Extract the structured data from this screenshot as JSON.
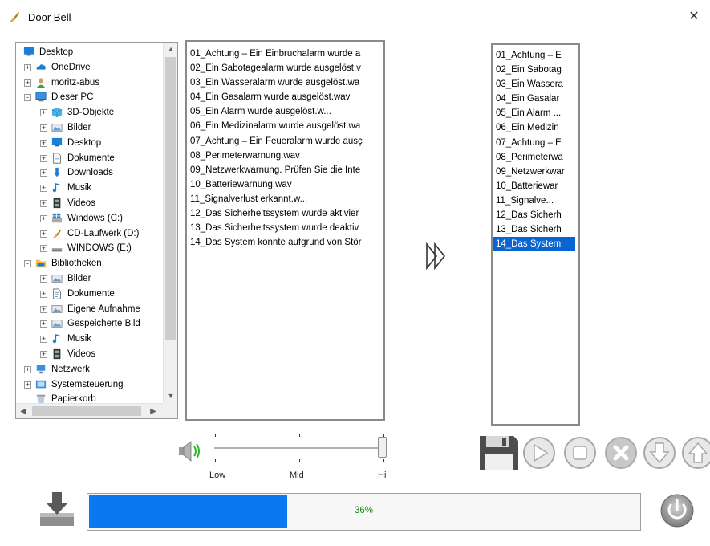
{
  "window": {
    "title": "Door Bell",
    "close_glyph": "✕",
    "icon": "broom-icon"
  },
  "tree": {
    "items": [
      {
        "label": "Desktop",
        "depth": 0,
        "expander": "",
        "icon": "desktop-blue-icon"
      },
      {
        "label": "OneDrive",
        "depth": 1,
        "expander": "+",
        "icon": "cloud-icon"
      },
      {
        "label": "moritz-abus",
        "depth": 1,
        "expander": "+",
        "icon": "user-icon"
      },
      {
        "label": "Dieser PC",
        "depth": 1,
        "expander": "-",
        "icon": "computer-icon"
      },
      {
        "label": "3D-Objekte",
        "depth": 2,
        "expander": "+",
        "icon": "cube-icon"
      },
      {
        "label": "Bilder",
        "depth": 2,
        "expander": "+",
        "icon": "pictures-icon"
      },
      {
        "label": "Desktop",
        "depth": 2,
        "expander": "+",
        "icon": "desktop-blue-icon"
      },
      {
        "label": "Dokumente",
        "depth": 2,
        "expander": "+",
        "icon": "document-icon"
      },
      {
        "label": "Downloads",
        "depth": 2,
        "expander": "+",
        "icon": "download-arrow-icon"
      },
      {
        "label": "Musik",
        "depth": 2,
        "expander": "+",
        "icon": "music-note-icon"
      },
      {
        "label": "Videos",
        "depth": 2,
        "expander": "+",
        "icon": "film-icon"
      },
      {
        "label": "Windows (C:)",
        "depth": 2,
        "expander": "+",
        "icon": "windows-drive-icon"
      },
      {
        "label": "CD-Laufwerk (D:)",
        "depth": 2,
        "expander": "+",
        "icon": "cd-drive-icon"
      },
      {
        "label": "WINDOWS (E:)",
        "depth": 2,
        "expander": "+",
        "icon": "drive-icon"
      },
      {
        "label": "Bibliotheken",
        "depth": 1,
        "expander": "-",
        "icon": "library-folder-icon"
      },
      {
        "label": "Bilder",
        "depth": 2,
        "expander": "+",
        "icon": "pictures-icon"
      },
      {
        "label": "Dokumente",
        "depth": 2,
        "expander": "+",
        "icon": "document-icon"
      },
      {
        "label": "Eigene Aufnahme",
        "depth": 2,
        "expander": "+",
        "icon": "pictures-icon"
      },
      {
        "label": "Gespeicherte Bild",
        "depth": 2,
        "expander": "+",
        "icon": "pictures-icon"
      },
      {
        "label": "Musik",
        "depth": 2,
        "expander": "+",
        "icon": "music-note-icon"
      },
      {
        "label": "Videos",
        "depth": 2,
        "expander": "+",
        "icon": "film-icon"
      },
      {
        "label": "Netzwerk",
        "depth": 1,
        "expander": "+",
        "icon": "network-icon"
      },
      {
        "label": "Systemsteuerung",
        "depth": 1,
        "expander": "+",
        "icon": "control-panel-icon"
      },
      {
        "label": "Papierkorb",
        "depth": 1,
        "expander": "",
        "icon": "recycle-bin-icon"
      }
    ]
  },
  "sound_files": [
    "01_Achtung – Ein Einbruchalarm wurde a",
    "02_Ein Sabotagealarm wurde ausgelöst.v",
    "03_Ein Wasseralarm wurde ausgelöst.wa",
    "04_Ein Gasalarm wurde ausgelöst.wav",
    "05_Ein Alarm wurde ausgelöst.w...",
    "06_Ein Medizinalarm wurde ausgelöst.wa",
    "07_Achtung – Ein Feueralarm wurde ausç",
    "08_Perimeterwarnung.wav",
    "09_Netzwerkwarnung. Prüfen Sie die Inte",
    "10_Batteriewarnung.wav",
    "11_Signalverlust erkannt.w...",
    "12_Das Sicherheitssystem wurde aktivier",
    "13_Das Sicherheitssystem wurde deaktiv",
    "14_Das System konnte aufgrund von Stör"
  ],
  "transfer_button": {
    "icon": "double-chevron-right-icon"
  },
  "playlist": {
    "items": [
      "01_Achtung – E",
      "02_Ein Sabotag",
      "03_Ein Wassera",
      "04_Ein Gasalar",
      "05_Ein Alarm ...",
      "06_Ein Medizin",
      "07_Achtung – E",
      "08_Perimeterwa",
      "09_Netzwerkwar",
      "10_Batteriewar",
      "11_Signalve...",
      "12_Das Sicherh",
      "13_Das Sicherh",
      "14_Das System"
    ],
    "selected_index": 13
  },
  "volume": {
    "labels": [
      "Low",
      "Mid",
      "Hi"
    ],
    "value": 1.0,
    "icon": "speaker-icon"
  },
  "controls": [
    {
      "name": "save",
      "icon": "floppy-disk-icon",
      "enabled": true
    },
    {
      "name": "play",
      "icon": "play-icon",
      "enabled": false
    },
    {
      "name": "stop",
      "icon": "stop-icon",
      "enabled": false
    },
    {
      "name": "delete",
      "icon": "x-icon",
      "enabled": false
    },
    {
      "name": "move-down",
      "icon": "arrow-down-icon",
      "enabled": false
    },
    {
      "name": "move-up",
      "icon": "arrow-up-icon",
      "enabled": false
    }
  ],
  "progress": {
    "value": 36,
    "label": "36%"
  },
  "colors": {
    "selection": "#0a64d2",
    "progress_fill": "#0a78f0",
    "progress_text": "#1a8a1a"
  }
}
